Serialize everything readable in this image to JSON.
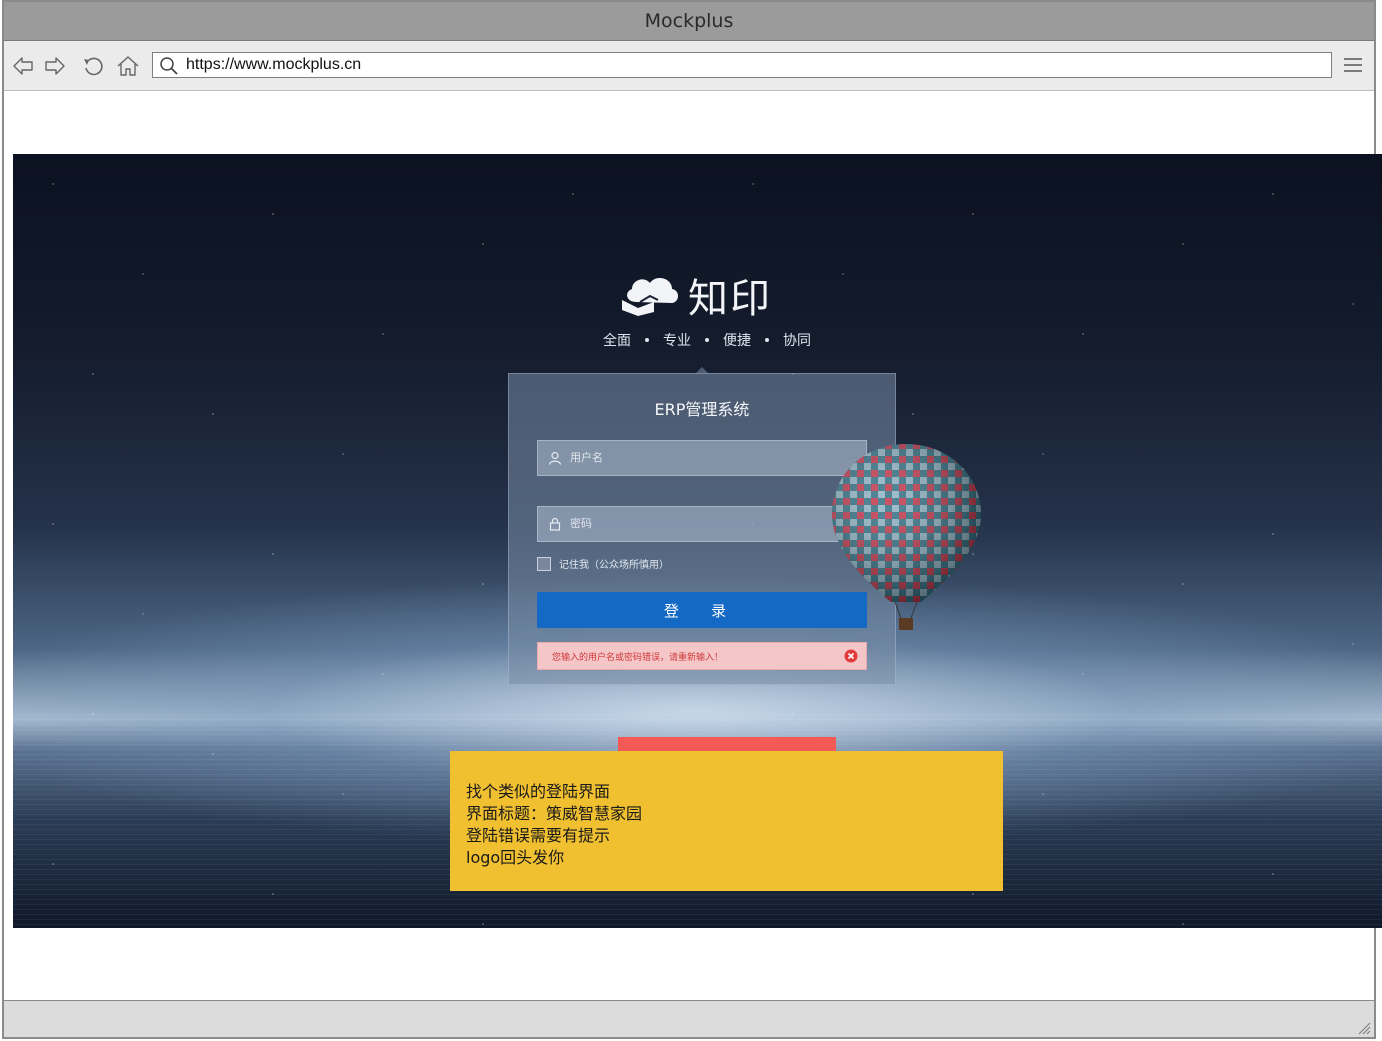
{
  "window": {
    "title": "Mockplus"
  },
  "toolbar": {
    "url": "https://www.mockplus.cn",
    "icons": [
      "back-icon",
      "forward-icon",
      "refresh-icon",
      "home-icon",
      "search-icon",
      "menu-icon"
    ]
  },
  "login_page": {
    "brand": "知印",
    "slogan": [
      "全面",
      "专业",
      "便捷",
      "协同"
    ],
    "card_title": "ERP管理系统",
    "username_placeholder": "用户名",
    "password_placeholder": "密码",
    "remember_label": "记住我（公众场所慎用）",
    "login_button": "登 录",
    "error_message": "您输入的用户名或密码错误，请重新输入！",
    "colors": {
      "login_button": "#1469c5",
      "error_bg": "#f4c6c8",
      "error_text": "#d13a3a"
    }
  },
  "note": {
    "lines": [
      "找个类似的登陆界面",
      "界面标题：策威智慧家园",
      "登陆错误需要有提示",
      "logo回头发你"
    ],
    "colors": {
      "background": "#f0c030",
      "tab": "#f45a55"
    }
  }
}
